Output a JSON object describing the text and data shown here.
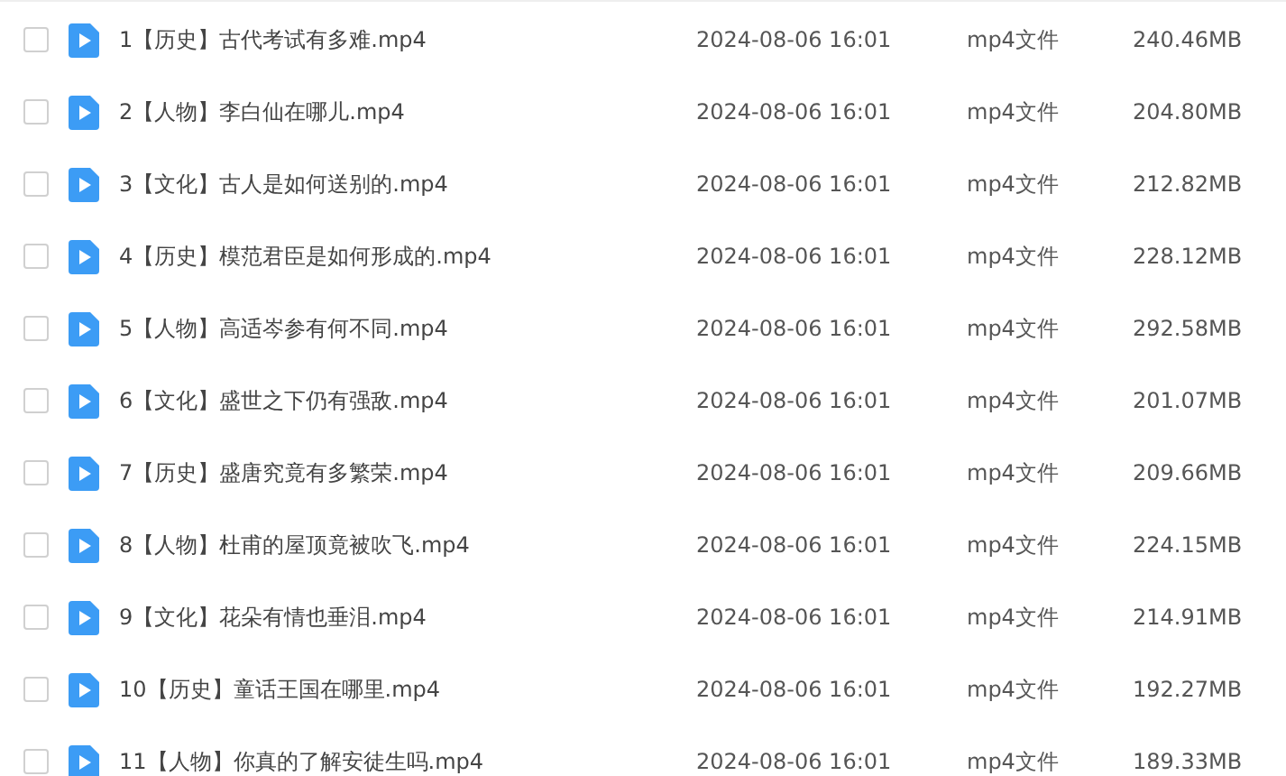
{
  "files": [
    {
      "name": "1【历史】古代考试有多难.mp4",
      "modified": "2024-08-06 16:01",
      "type": "mp4文件",
      "size": "240.46MB",
      "checked": false
    },
    {
      "name": "2【人物】李白仙在哪儿.mp4",
      "modified": "2024-08-06 16:01",
      "type": "mp4文件",
      "size": "204.80MB",
      "checked": false
    },
    {
      "name": "3【文化】古人是如何送别的.mp4",
      "modified": "2024-08-06 16:01",
      "type": "mp4文件",
      "size": "212.82MB",
      "checked": false
    },
    {
      "name": "4【历史】模范君臣是如何形成的.mp4",
      "modified": "2024-08-06 16:01",
      "type": "mp4文件",
      "size": "228.12MB",
      "checked": false
    },
    {
      "name": "5【人物】高适岑参有何不同.mp4",
      "modified": "2024-08-06 16:01",
      "type": "mp4文件",
      "size": "292.58MB",
      "checked": false
    },
    {
      "name": "6【文化】盛世之下仍有强敌.mp4",
      "modified": "2024-08-06 16:01",
      "type": "mp4文件",
      "size": "201.07MB",
      "checked": false
    },
    {
      "name": "7【历史】盛唐究竟有多繁荣.mp4",
      "modified": "2024-08-06 16:01",
      "type": "mp4文件",
      "size": "209.66MB",
      "checked": false
    },
    {
      "name": "8【人物】杜甫的屋顶竟被吹飞.mp4",
      "modified": "2024-08-06 16:01",
      "type": "mp4文件",
      "size": "224.15MB",
      "checked": false
    },
    {
      "name": "9【文化】花朵有情也垂泪.mp4",
      "modified": "2024-08-06 16:01",
      "type": "mp4文件",
      "size": "214.91MB",
      "checked": false
    },
    {
      "name": "10【历史】童话王国在哪里.mp4",
      "modified": "2024-08-06 16:01",
      "type": "mp4文件",
      "size": "192.27MB",
      "checked": false
    },
    {
      "name": "11【人物】你真的了解安徒生吗.mp4",
      "modified": "2024-08-06 16:01",
      "type": "mp4文件",
      "size": "189.33MB",
      "checked": false
    }
  ]
}
